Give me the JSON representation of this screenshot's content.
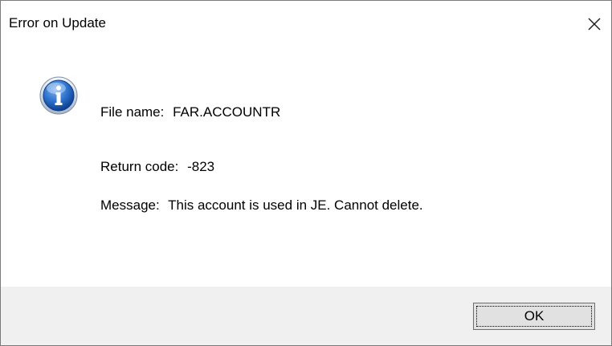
{
  "window": {
    "title": "Error on Update",
    "close_icon": "close-icon"
  },
  "content": {
    "icon": "info-icon",
    "file": {
      "label": "File name:",
      "value": "FAR.ACCOUNTR"
    },
    "return_code": {
      "label": "Return code:",
      "value": "-823"
    },
    "message": {
      "label": "Message:",
      "value": "This account is used in JE. Cannot delete."
    }
  },
  "footer": {
    "ok_label": "OK"
  },
  "colors": {
    "footer_bg": "#f0f0f0",
    "info_blue": "#1f67c8"
  }
}
